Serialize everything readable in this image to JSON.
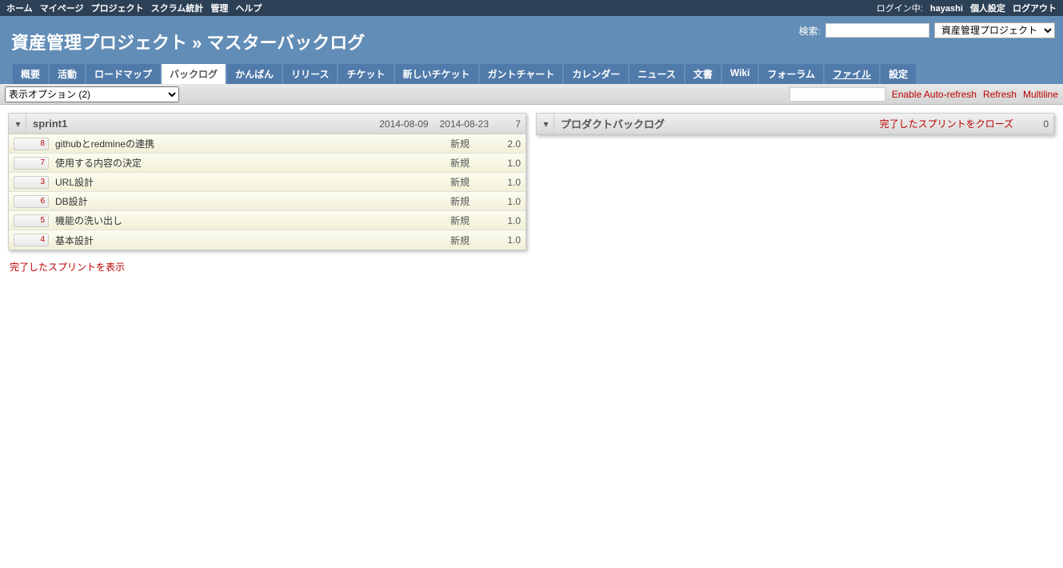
{
  "top_menu": {
    "left": [
      "ホーム",
      "マイページ",
      "プロジェクト",
      "スクラム統計",
      "管理",
      "ヘルプ"
    ],
    "logged_in_label": "ログイン中:",
    "user": "hayashi",
    "right": [
      "個人設定",
      "ログアウト"
    ]
  },
  "header": {
    "title": "資産管理プロジェクト » マスターバックログ",
    "search_label": "検索:",
    "project_select": "資産管理プロジェクト"
  },
  "main_menu": [
    "概要",
    "活動",
    "ロードマップ",
    "バックログ",
    "かんばん",
    "リリース",
    "チケット",
    "新しいチケット",
    "ガントチャート",
    "カレンダー",
    "ニュース",
    "文書",
    "Wiki",
    "フォーラム",
    "ファイル",
    "設定"
  ],
  "main_menu_selected": 3,
  "main_menu_underline": 14,
  "toolbar": {
    "view_options": "表示オプション (2)",
    "enable_autorefresh": "Enable Auto-refresh",
    "refresh": "Refresh",
    "multiline": "Multiline"
  },
  "sprint_panel": {
    "title": "sprint1",
    "start_date": "2014-08-09",
    "end_date": "2014-08-23",
    "total_points": "7",
    "stories": [
      {
        "id": "8",
        "subject": "githubとredmineの連携",
        "status": "新規",
        "points": "2.0"
      },
      {
        "id": "7",
        "subject": "使用する内容の決定",
        "status": "新規",
        "points": "1.0"
      },
      {
        "id": "3",
        "subject": "URL設計",
        "status": "新規",
        "points": "1.0"
      },
      {
        "id": "6",
        "subject": "DB設計",
        "status": "新規",
        "points": "1.0"
      },
      {
        "id": "5",
        "subject": "機能の洗い出し",
        "status": "新規",
        "points": "1.0"
      },
      {
        "id": "4",
        "subject": "基本設計",
        "status": "新規",
        "points": "1.0"
      }
    ]
  },
  "product_backlog": {
    "title": "プロダクトバックログ",
    "close_link": "完了したスプリントをクローズ",
    "count": "0"
  },
  "show_closed_sprints": "完了したスプリントを表示"
}
